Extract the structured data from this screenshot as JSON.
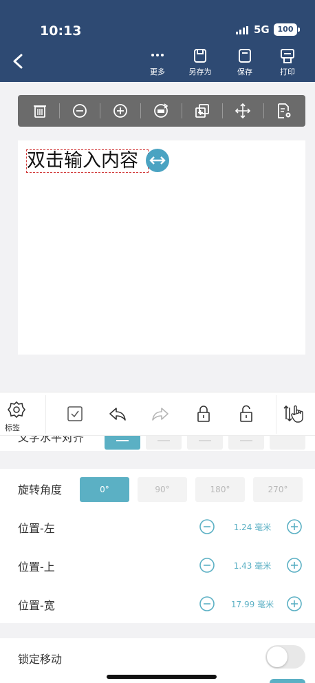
{
  "status_bar": {
    "time": "10:13",
    "network": "5G",
    "battery": "100"
  },
  "header": {
    "more_label": "更多",
    "save_as_label": "另存为",
    "save_label": "保存",
    "print_label": "打印"
  },
  "edit_toolbar": {
    "items": [
      "delete-icon",
      "zoom-out-icon",
      "zoom-in-icon",
      "rotate-90-icon",
      "copy-add-icon",
      "move-icon",
      "settings-icon"
    ]
  },
  "canvas": {
    "text": "双击输入内容"
  },
  "quick_bar": {
    "tag_label": "标签"
  },
  "properties": {
    "text_align_label": "文字水平对齐",
    "rotation": {
      "label": "旋转角度",
      "options": [
        "0°",
        "90°",
        "180°",
        "270°"
      ],
      "selected": "0°"
    },
    "left": {
      "label": "位置-左",
      "value": "1.24 毫米"
    },
    "top": {
      "label": "位置-上",
      "value": "1.43 毫米"
    },
    "width": {
      "label": "位置-宽",
      "value": "17.99 毫米"
    },
    "lock": {
      "label": "锁定移动",
      "on": false
    }
  },
  "colors": {
    "header_bg": "#2e4a73",
    "accent": "#5bb0c4",
    "toolbar_bg": "#6b6b6b"
  }
}
